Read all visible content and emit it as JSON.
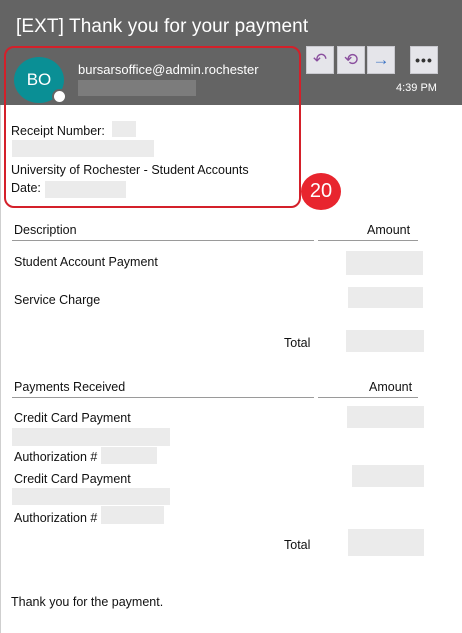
{
  "email": {
    "subject": "[EXT] Thank you for your payment",
    "avatar_initials": "BO",
    "sender": "bursarsoffice@admin.rochester",
    "time": "4:39 PM"
  },
  "actions": {
    "reply_icon": "↶",
    "reply_all_icon": "⟲",
    "forward_icon": "→",
    "more_icon": "•••"
  },
  "annotation": {
    "step_number": "20",
    "highlight_color": "#d4202a"
  },
  "body": {
    "receipt_label": "Receipt Number:",
    "org_line": "University of Rochester - Student Accounts",
    "date_label": "Date:",
    "charges_table": {
      "col_description": "Description",
      "col_amount": "Amount",
      "rows": [
        "Student Account Payment",
        "Service Charge"
      ],
      "total_label": "Total"
    },
    "payments_table": {
      "col_description": "Payments Received",
      "col_amount": "Amount",
      "items": [
        {
          "method": "Credit Card Payment",
          "auth_label": "Authorization #"
        },
        {
          "method": "Credit Card Payment",
          "auth_label": "Authorization #"
        }
      ],
      "total_label": "Total"
    },
    "closing": "Thank you for the payment."
  }
}
